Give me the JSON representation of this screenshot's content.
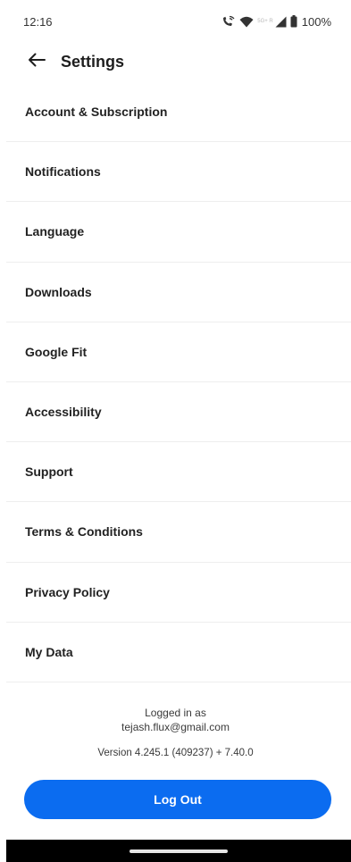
{
  "status_bar": {
    "time": "12:16",
    "network_label": "5G+ R",
    "battery": "100%"
  },
  "header": {
    "title": "Settings",
    "back_icon": "arrow-left-icon"
  },
  "settings": {
    "items": [
      {
        "label": "Account & Subscription"
      },
      {
        "label": "Notifications"
      },
      {
        "label": "Language"
      },
      {
        "label": "Downloads"
      },
      {
        "label": "Google Fit"
      },
      {
        "label": "Accessibility"
      },
      {
        "label": "Support"
      },
      {
        "label": "Terms & Conditions"
      },
      {
        "label": "Privacy Policy"
      },
      {
        "label": "My Data"
      }
    ]
  },
  "footer": {
    "logged_in_label": "Logged in as",
    "email": "tejash.flux@gmail.com",
    "version": "Version 4.245.1 (409237) + 7.40.0",
    "logout_label": "Log Out"
  },
  "colors": {
    "accent": "#0b6cf0",
    "divider": "#eeeeee",
    "nav_bar": "#000000"
  }
}
